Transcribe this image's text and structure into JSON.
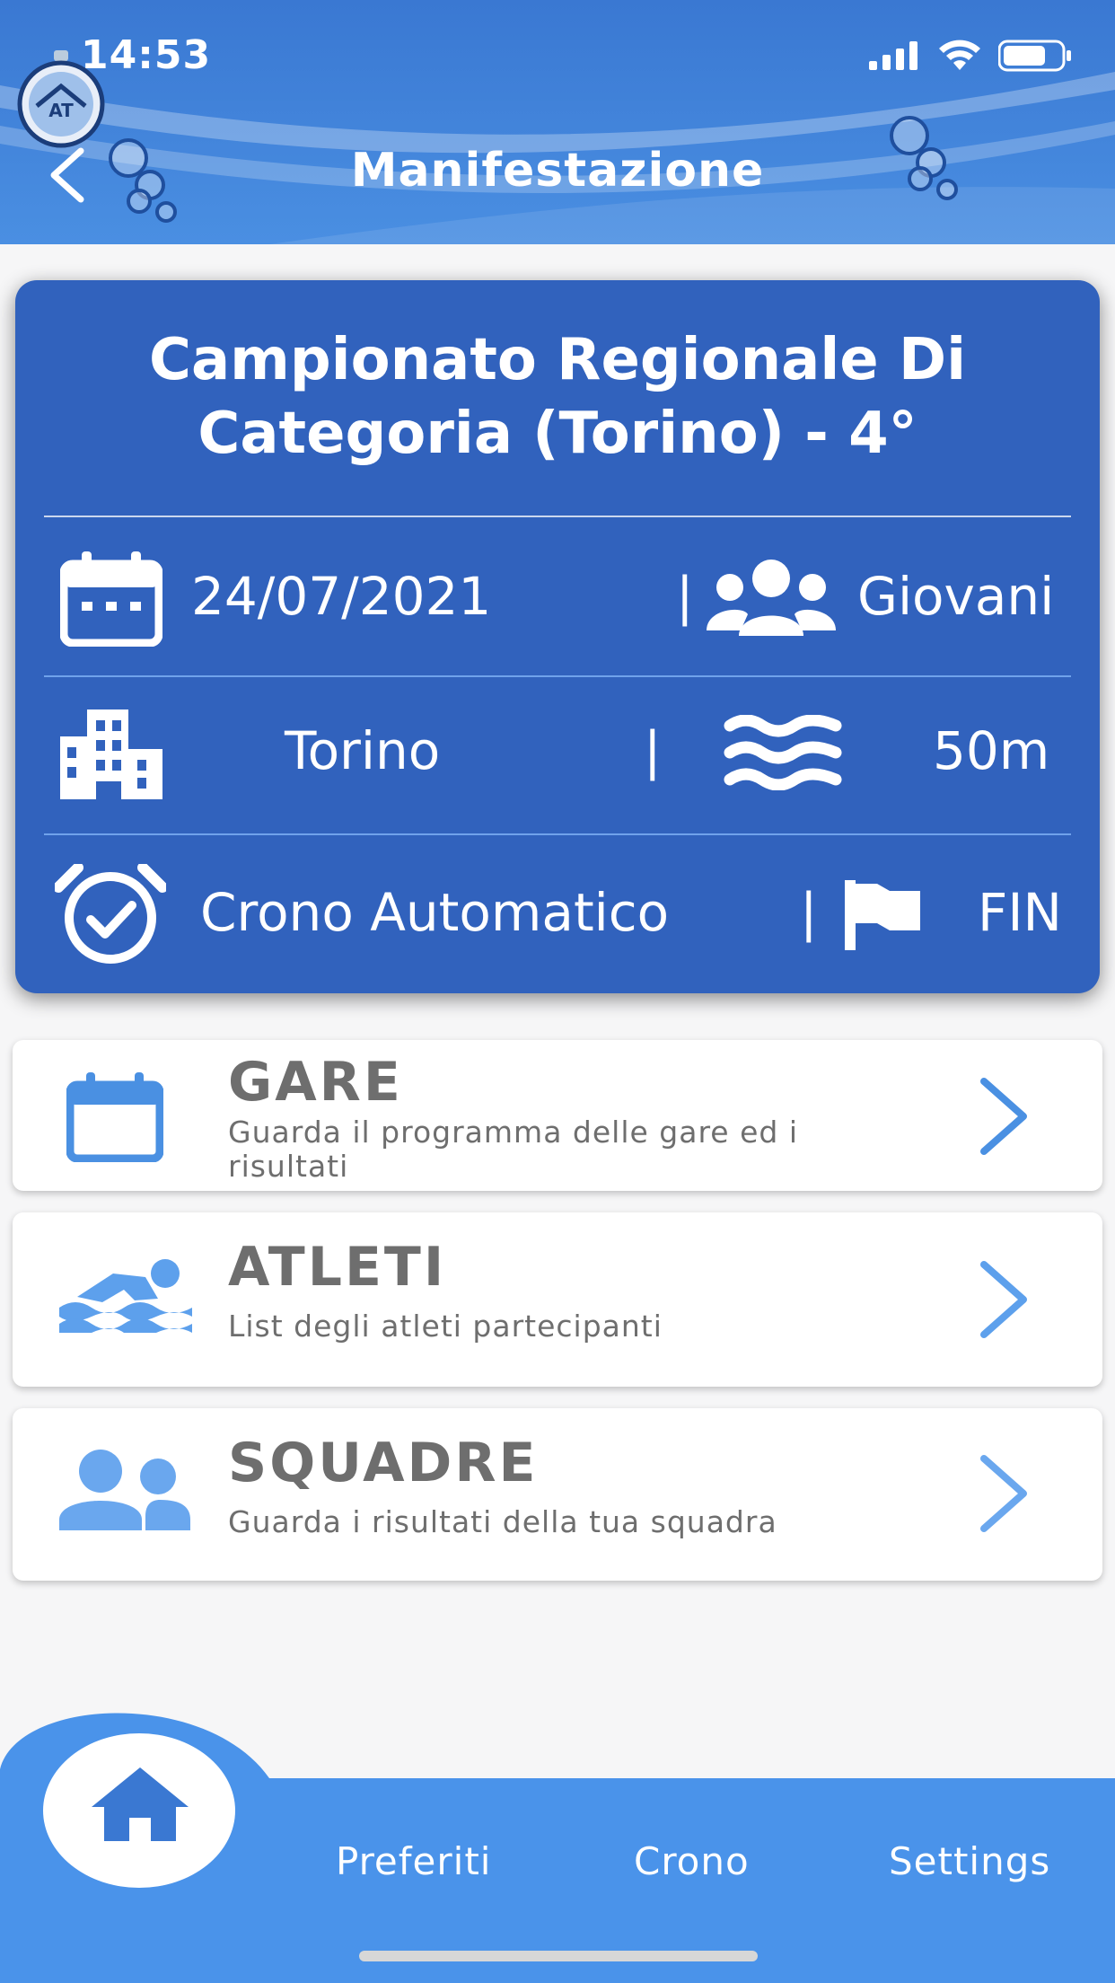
{
  "status_bar": {
    "time": "14:53"
  },
  "header": {
    "title": "Manifestazione"
  },
  "event": {
    "title_line1": "Campionato Regionale Di",
    "title_line2": "Categoria (Torino) - 4°",
    "date": "24/07/2021",
    "category": "Giovani",
    "city": "Torino",
    "pool_length": "50m",
    "timing": "Crono Automatico",
    "federation": "FIN",
    "separator": "|"
  },
  "menu": [
    {
      "title": "GARE",
      "subtitle": "Guarda il programma delle gare ed i risultati",
      "icon": "calendar-icon"
    },
    {
      "title": "ATLETI",
      "subtitle": "List degli atleti partecipanti",
      "icon": "swimmer-icon"
    },
    {
      "title": "SQUADRE",
      "subtitle": "Guarda i risultati della tua squadra",
      "icon": "users-icon"
    }
  ],
  "bottom_nav": {
    "home_icon": "home-icon",
    "preferiti": "Preferiti",
    "crono": "Crono",
    "settings": "Settings"
  },
  "colors": {
    "header": "#3a78d2",
    "card": "#3162bd",
    "accent": "#4a90e2",
    "nav": "#4a93ea",
    "text_gray": "#6e6e6e"
  }
}
